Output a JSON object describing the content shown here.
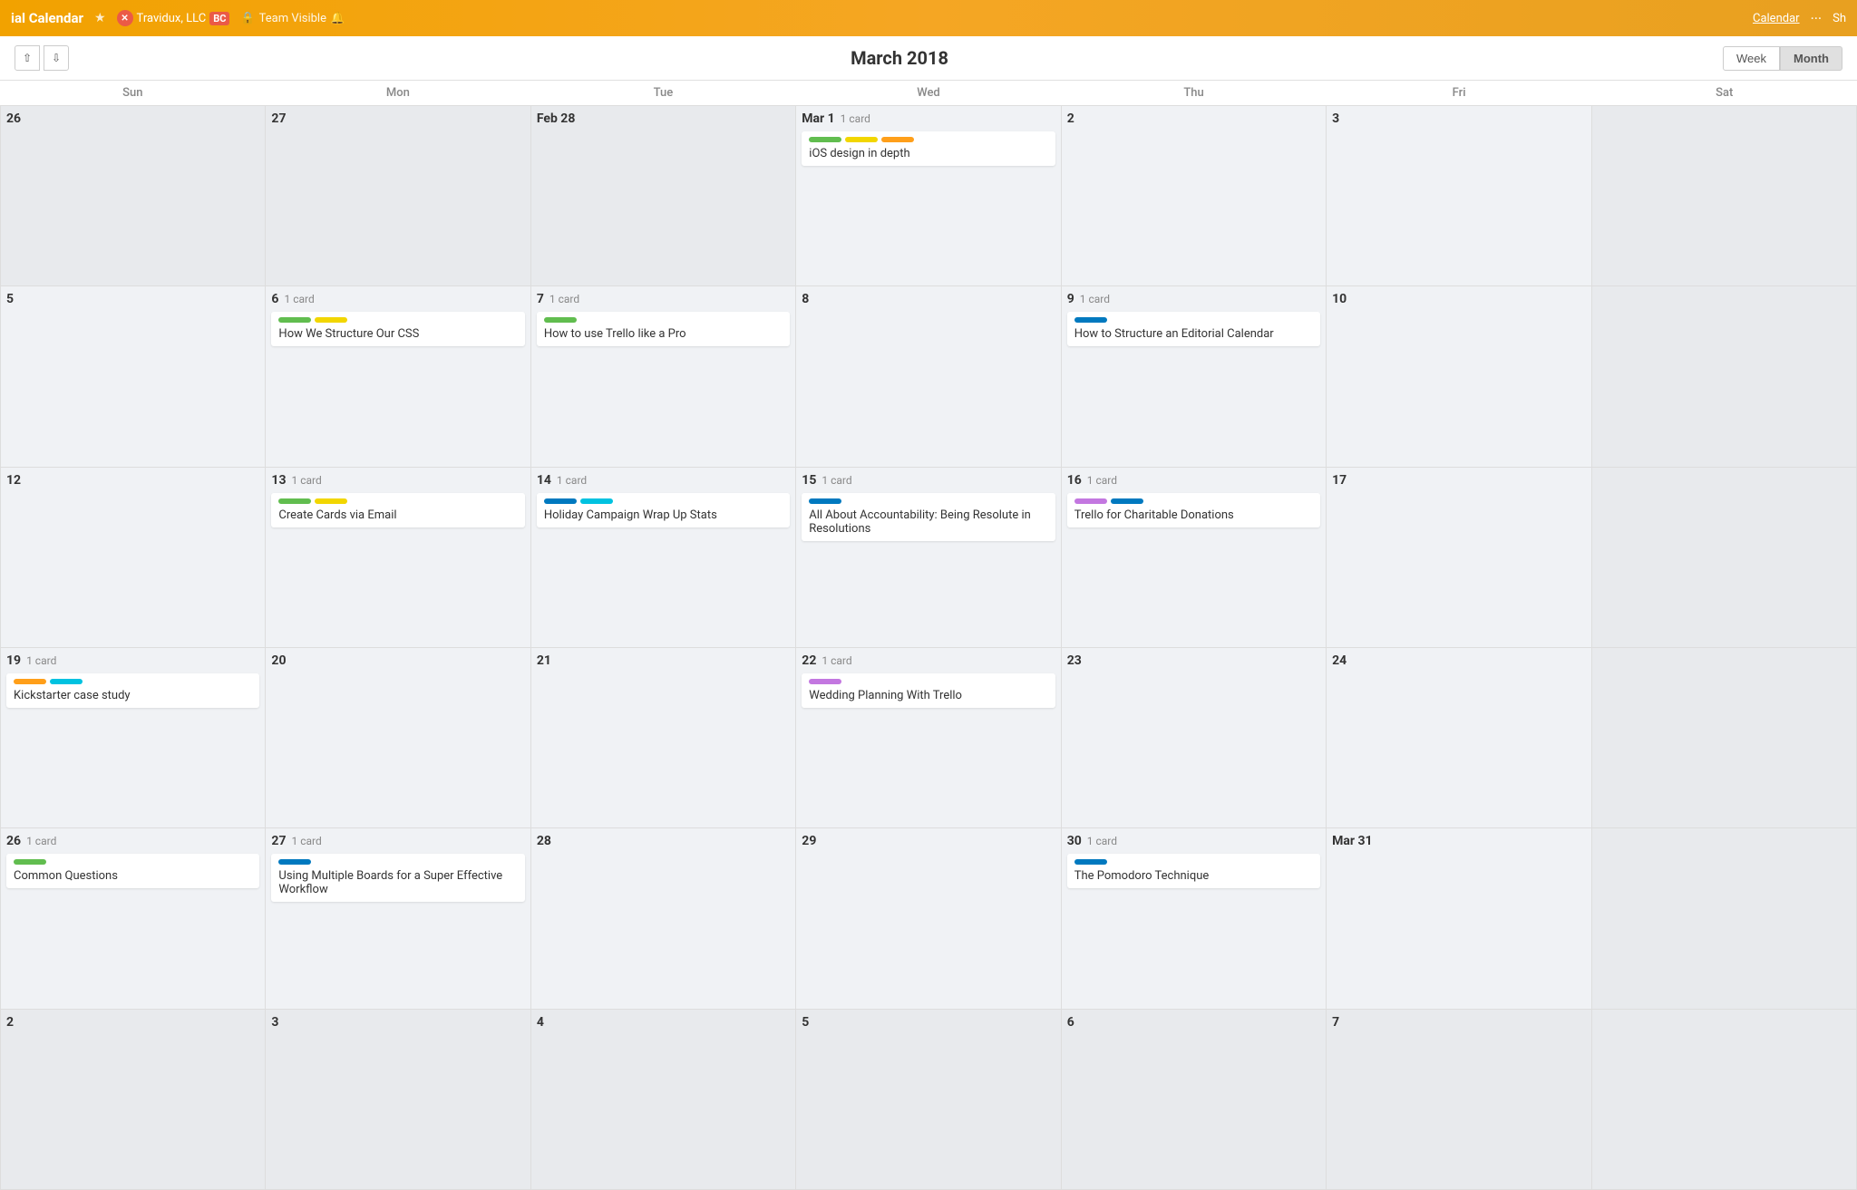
{
  "topbar": {
    "title": "ial Calendar",
    "star_icon": "★",
    "company": "Travidux, LLC",
    "badge": "BC",
    "team": "Team Visible",
    "calendar_link": "Calendar",
    "more": "···",
    "share": "Sh"
  },
  "header": {
    "title": "March 2018",
    "week_label": "Week",
    "month_label": "Month"
  },
  "dow": [
    "Sun",
    "Mon",
    "Tue",
    "Wed",
    "Thu",
    "Fri",
    "Sat"
  ],
  "weeks": [
    {
      "days": [
        {
          "label": "26",
          "inMonth": false,
          "count": null,
          "cards": []
        },
        {
          "label": "27",
          "inMonth": false,
          "count": null,
          "cards": []
        },
        {
          "label": "Feb 28",
          "inMonth": false,
          "count": null,
          "cards": []
        },
        {
          "label": "Mar 1",
          "inMonth": true,
          "count": "1 card",
          "cards": [
            {
              "title": "iOS design in depth",
              "labels": [
                "green",
                "yellow",
                "orange"
              ]
            }
          ]
        },
        {
          "label": "2",
          "inMonth": true,
          "count": null,
          "cards": []
        },
        {
          "label": "3",
          "inMonth": true,
          "count": null,
          "cards": []
        },
        {
          "label": "",
          "inMonth": false,
          "count": null,
          "cards": []
        }
      ]
    },
    {
      "days": [
        {
          "label": "5",
          "inMonth": true,
          "count": null,
          "cards": []
        },
        {
          "label": "6",
          "inMonth": true,
          "count": "1 card",
          "cards": [
            {
              "title": "How We Structure Our CSS",
              "labels": [
                "green",
                "yellow"
              ]
            }
          ]
        },
        {
          "label": "7",
          "inMonth": true,
          "count": "1 card",
          "cards": [
            {
              "title": "How to use Trello like a Pro",
              "labels": [
                "green"
              ]
            }
          ]
        },
        {
          "label": "8",
          "inMonth": true,
          "count": null,
          "cards": []
        },
        {
          "label": "9",
          "inMonth": true,
          "count": "1 card",
          "cards": [
            {
              "title": "How to Structure an Editorial Calendar",
              "labels": [
                "blue"
              ]
            }
          ]
        },
        {
          "label": "10",
          "inMonth": true,
          "count": null,
          "cards": []
        },
        {
          "label": "",
          "inMonth": false,
          "count": null,
          "cards": []
        }
      ]
    },
    {
      "days": [
        {
          "label": "12",
          "inMonth": true,
          "count": null,
          "cards": []
        },
        {
          "label": "13",
          "inMonth": true,
          "count": "1 card",
          "cards": [
            {
              "title": "Create Cards via Email",
              "labels": [
                "green",
                "yellow"
              ]
            }
          ]
        },
        {
          "label": "14",
          "inMonth": true,
          "count": "1 card",
          "cards": [
            {
              "title": "Holiday Campaign Wrap Up Stats",
              "labels": [
                "blue",
                "cyan"
              ]
            }
          ]
        },
        {
          "label": "15",
          "inMonth": true,
          "count": "1 card",
          "cards": [
            {
              "title": "All About Accountability: Being Resolute in Resolutions",
              "labels": [
                "blue"
              ]
            }
          ]
        },
        {
          "label": "16",
          "inMonth": true,
          "count": "1 card",
          "cards": [
            {
              "title": "Trello for Charitable Donations",
              "labels": [
                "purple",
                "blue"
              ]
            }
          ]
        },
        {
          "label": "17",
          "inMonth": true,
          "count": null,
          "cards": []
        },
        {
          "label": "",
          "inMonth": false,
          "count": null,
          "cards": []
        }
      ]
    },
    {
      "days": [
        {
          "label": "19",
          "inMonth": true,
          "count": "1 card",
          "cards": [
            {
              "title": "Kickstarter case study",
              "labels": [
                "orange",
                "cyan"
              ]
            }
          ]
        },
        {
          "label": "20",
          "inMonth": true,
          "count": null,
          "cards": []
        },
        {
          "label": "21",
          "inMonth": true,
          "count": null,
          "cards": []
        },
        {
          "label": "22",
          "inMonth": true,
          "count": "1 card",
          "cards": [
            {
              "title": "Wedding Planning With Trello",
              "labels": [
                "purple"
              ]
            }
          ]
        },
        {
          "label": "23",
          "inMonth": true,
          "count": null,
          "cards": []
        },
        {
          "label": "24",
          "inMonth": true,
          "count": null,
          "cards": []
        },
        {
          "label": "",
          "inMonth": false,
          "count": null,
          "cards": []
        }
      ]
    },
    {
      "days": [
        {
          "label": "26",
          "inMonth": true,
          "count": "1 card",
          "cards": [
            {
              "title": "Common Questions",
              "labels": [
                "green"
              ]
            }
          ]
        },
        {
          "label": "27",
          "inMonth": true,
          "count": "1 card",
          "cards": [
            {
              "title": "Using Multiple Boards for a Super Effective Workflow",
              "labels": [
                "blue"
              ]
            }
          ]
        },
        {
          "label": "28",
          "inMonth": true,
          "count": null,
          "cards": []
        },
        {
          "label": "29",
          "inMonth": true,
          "count": null,
          "cards": []
        },
        {
          "label": "30",
          "inMonth": true,
          "count": "1 card",
          "cards": [
            {
              "title": "The Pomodoro Technique",
              "labels": [
                "blue"
              ]
            }
          ]
        },
        {
          "label": "Mar 31",
          "inMonth": true,
          "count": null,
          "cards": []
        },
        {
          "label": "",
          "inMonth": false,
          "count": null,
          "cards": []
        }
      ]
    },
    {
      "days": [
        {
          "label": "2",
          "inMonth": false,
          "count": null,
          "cards": []
        },
        {
          "label": "3",
          "inMonth": false,
          "count": null,
          "cards": []
        },
        {
          "label": "4",
          "inMonth": false,
          "count": null,
          "cards": []
        },
        {
          "label": "5",
          "inMonth": false,
          "count": null,
          "cards": []
        },
        {
          "label": "6",
          "inMonth": false,
          "count": null,
          "cards": []
        },
        {
          "label": "7",
          "inMonth": false,
          "count": null,
          "cards": []
        },
        {
          "label": "",
          "inMonth": false,
          "count": null,
          "cards": []
        }
      ]
    }
  ]
}
